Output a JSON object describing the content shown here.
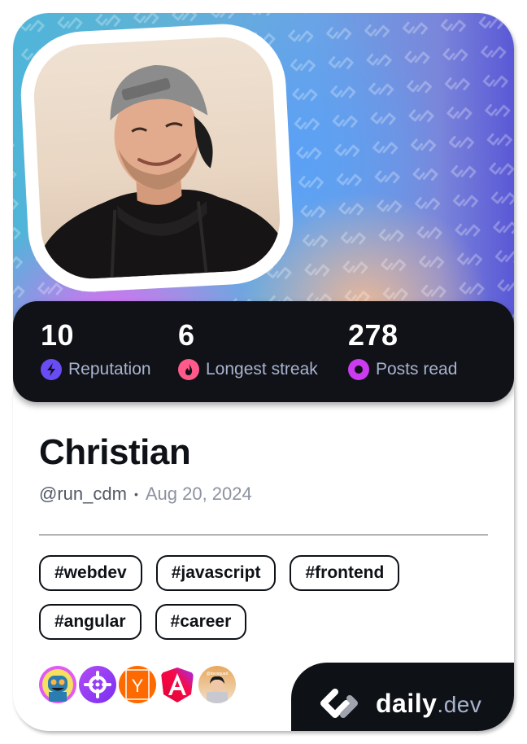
{
  "profile": {
    "name": "Christian",
    "handle": "@run_cdm",
    "separator": "•",
    "joined": "Aug 20, 2024",
    "avatar_alt": "Profile photo of Christian"
  },
  "stats": [
    {
      "value": "10",
      "label": "Reputation",
      "icon": "lightning-icon",
      "color": "#6a4cf5"
    },
    {
      "value": "6",
      "label": "Longest streak",
      "icon": "flame-icon",
      "color": "#ff5a8a"
    },
    {
      "value": "278",
      "label": "Posts read",
      "icon": "eye-icon",
      "color": "#cc3bf0"
    }
  ],
  "tags": [
    "#webdev",
    "#javascript",
    "#frontend",
    "#angular",
    "#career"
  ],
  "sources": [
    {
      "name": "robot-avatar-source",
      "colors": [
        "#e05cf0",
        "#f5e060",
        "#2a7db0"
      ]
    },
    {
      "name": "crosshair-source",
      "colors": [
        "#8a3cf0",
        "#ffffff"
      ]
    },
    {
      "name": "hacker-news-source",
      "letter": "Y",
      "colors": [
        "#ff6a00",
        "#ffffff"
      ]
    },
    {
      "name": "angular-source",
      "letter": "A",
      "colors": [
        "#e40035",
        "#9b30ff"
      ]
    },
    {
      "name": "devsquad-source",
      "caption": "@devsquad",
      "colors": [
        "#e8b070",
        "#f2e0c8"
      ]
    }
  ],
  "brand": {
    "name": "daily",
    "tld": ".dev"
  },
  "colors": {
    "dark": "#0e1217",
    "stat_label": "#a8b3cf",
    "meta": "#525866",
    "date": "#8c92a0"
  }
}
